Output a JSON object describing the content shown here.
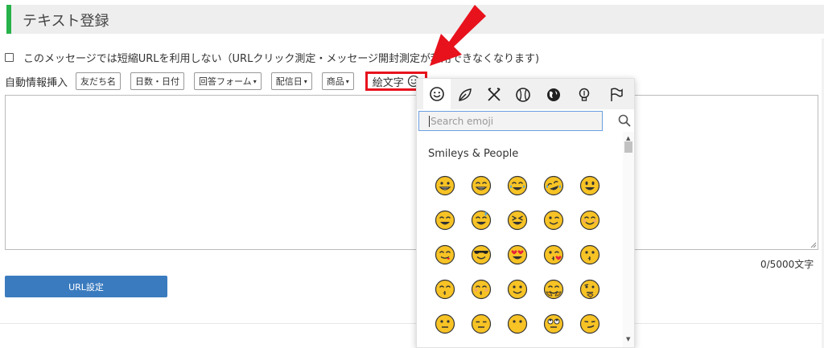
{
  "header": {
    "title": "テキスト登録"
  },
  "option": {
    "label": "このメッセージでは短縮URLを利用しない（URLクリック測定・メッセージ開封測定が利用できなくなります)",
    "checked": false
  },
  "toolbar": {
    "label": "自動情報挿入",
    "buttons": [
      {
        "label": "友だち名",
        "caret": ""
      },
      {
        "label": "日数・日付",
        "caret": ""
      },
      {
        "label": "回答フォーム",
        "caret": "▾"
      },
      {
        "label": "配信日",
        "caret": "▾"
      },
      {
        "label": "商品",
        "caret": "▾"
      }
    ],
    "emoji_button": "絵文字"
  },
  "editor": {
    "value": "",
    "counter": "0/5000文字"
  },
  "url_button": "URL設定",
  "emoji_picker": {
    "categories": [
      "smileys-icon",
      "leaf-icon",
      "utensils-icon",
      "ball-icon",
      "globe-icon",
      "lightbulb-icon",
      "flag-icon"
    ],
    "active_category": "smileys-icon",
    "search_placeholder": "Search emoji",
    "section_title": "Smileys & People",
    "emojis": [
      "grinning",
      "grin",
      "joy",
      "rofl",
      "smiley",
      "smile",
      "sweat-smile",
      "laughing",
      "wink",
      "blush",
      "yum",
      "sunglasses",
      "heart-eyes",
      "kissing-heart",
      "kissing",
      "kissing-smiling-eyes",
      "kissing-closed-eyes",
      "slightly-smiling",
      "hugging",
      "thinking",
      "neutral",
      "expressionless",
      "no-mouth",
      "rolling-eyes",
      "smirk"
    ]
  },
  "colors": {
    "accent_green": "#27b24a",
    "highlight_red": "#e8121d",
    "button_blue": "#3a7bbf",
    "emoji_yellow": "#f7c325"
  }
}
